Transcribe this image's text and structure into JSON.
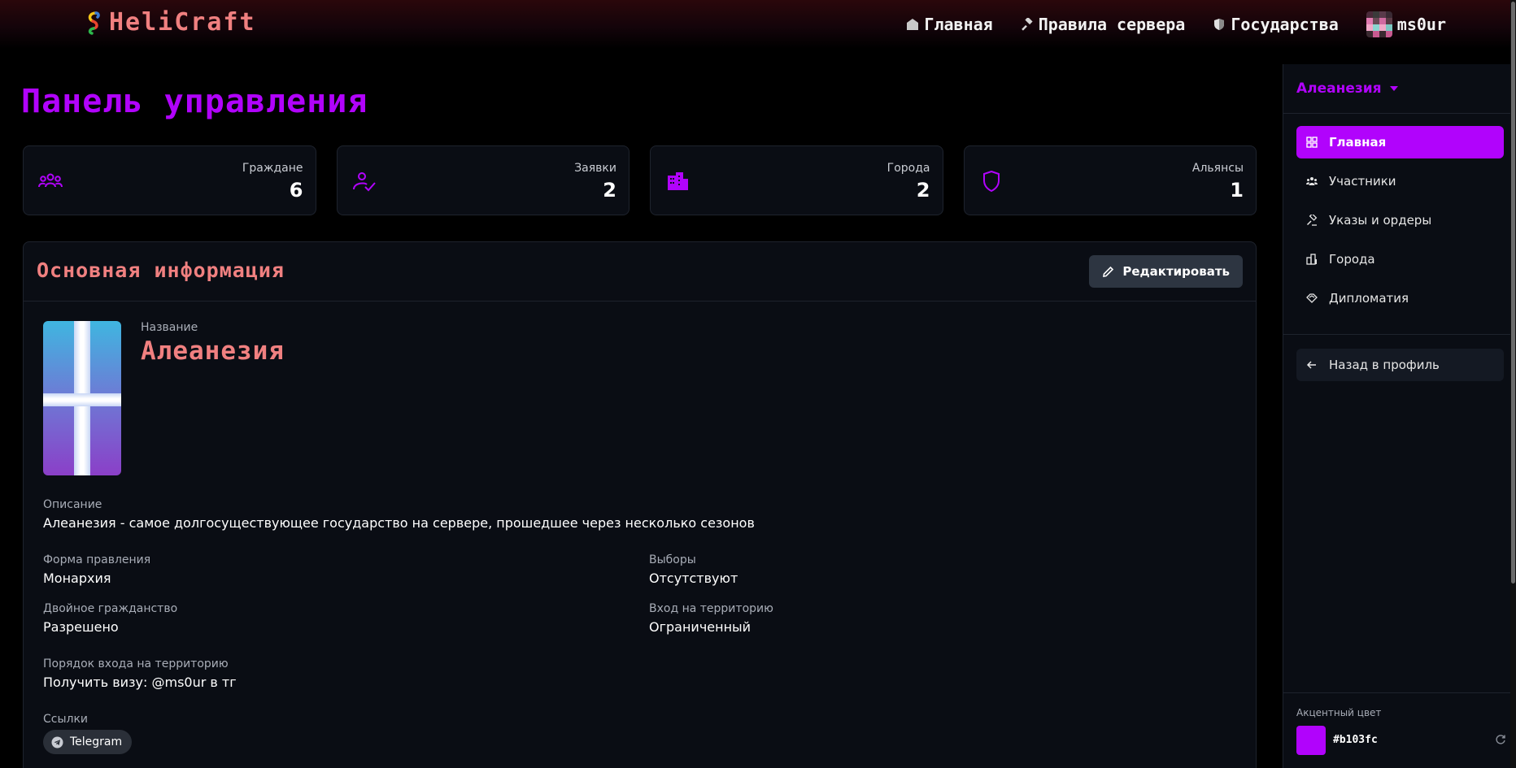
{
  "header": {
    "brand": "HeliCraft",
    "nav": [
      {
        "label": "Главная",
        "icon": "home-icon"
      },
      {
        "label": "Правила сервера",
        "icon": "gavel-icon"
      },
      {
        "label": "Государства",
        "icon": "shield-icon"
      }
    ],
    "user": {
      "name": "ms0ur",
      "icon": "avatar"
    }
  },
  "page_title": "Панель управления",
  "stats": [
    {
      "label": "Граждане",
      "value": "6",
      "icon": "users-icon"
    },
    {
      "label": "Заявки",
      "value": "2",
      "icon": "user-check-icon"
    },
    {
      "label": "Города",
      "value": "2",
      "icon": "buildings-icon"
    },
    {
      "label": "Альянсы",
      "value": "1",
      "icon": "shield-icon"
    }
  ],
  "main_card": {
    "title": "Основная информация",
    "edit_label": "Редактировать",
    "name_label": "Название",
    "name_value": "Алеанезия",
    "description_label": "Описание",
    "description_value": "Алеанезия - самое долгосуществующее государство на сервере, прошедшее через несколько сезонов",
    "government_label": "Форма правления",
    "government_value": "Монархия",
    "elections_label": "Выборы",
    "elections_value": "Отсутствуют",
    "dual_label": "Двойное гражданство",
    "dual_value": "Разрешено",
    "entry_label": "Вход на территорию",
    "entry_value": "Ограниченный",
    "entry_order_label": "Порядок входа на территорию",
    "entry_order_value": "Получить визу: @ms0ur в тг",
    "links_label": "Ссылки",
    "links": [
      {
        "label": "Telegram",
        "icon": "telegram-icon"
      }
    ]
  },
  "sidebar": {
    "state_name": "Алеанезия",
    "items": [
      {
        "label": "Главная",
        "icon": "grid-icon",
        "active": true
      },
      {
        "label": "Участники",
        "icon": "users-icon"
      },
      {
        "label": "Указы и ордеры",
        "icon": "gavel-icon"
      },
      {
        "label": "Города",
        "icon": "buildings-icon"
      },
      {
        "label": "Дипломатия",
        "icon": "handshake-icon"
      }
    ],
    "back_label": "Назад в профиль",
    "accent_label": "Акцентный цвет",
    "accent_hex": "#b103fc"
  },
  "colors": {
    "accent": "#b103fc",
    "heading": "#f08080",
    "card_bg": "#0a0d14",
    "border": "#1e232d"
  }
}
